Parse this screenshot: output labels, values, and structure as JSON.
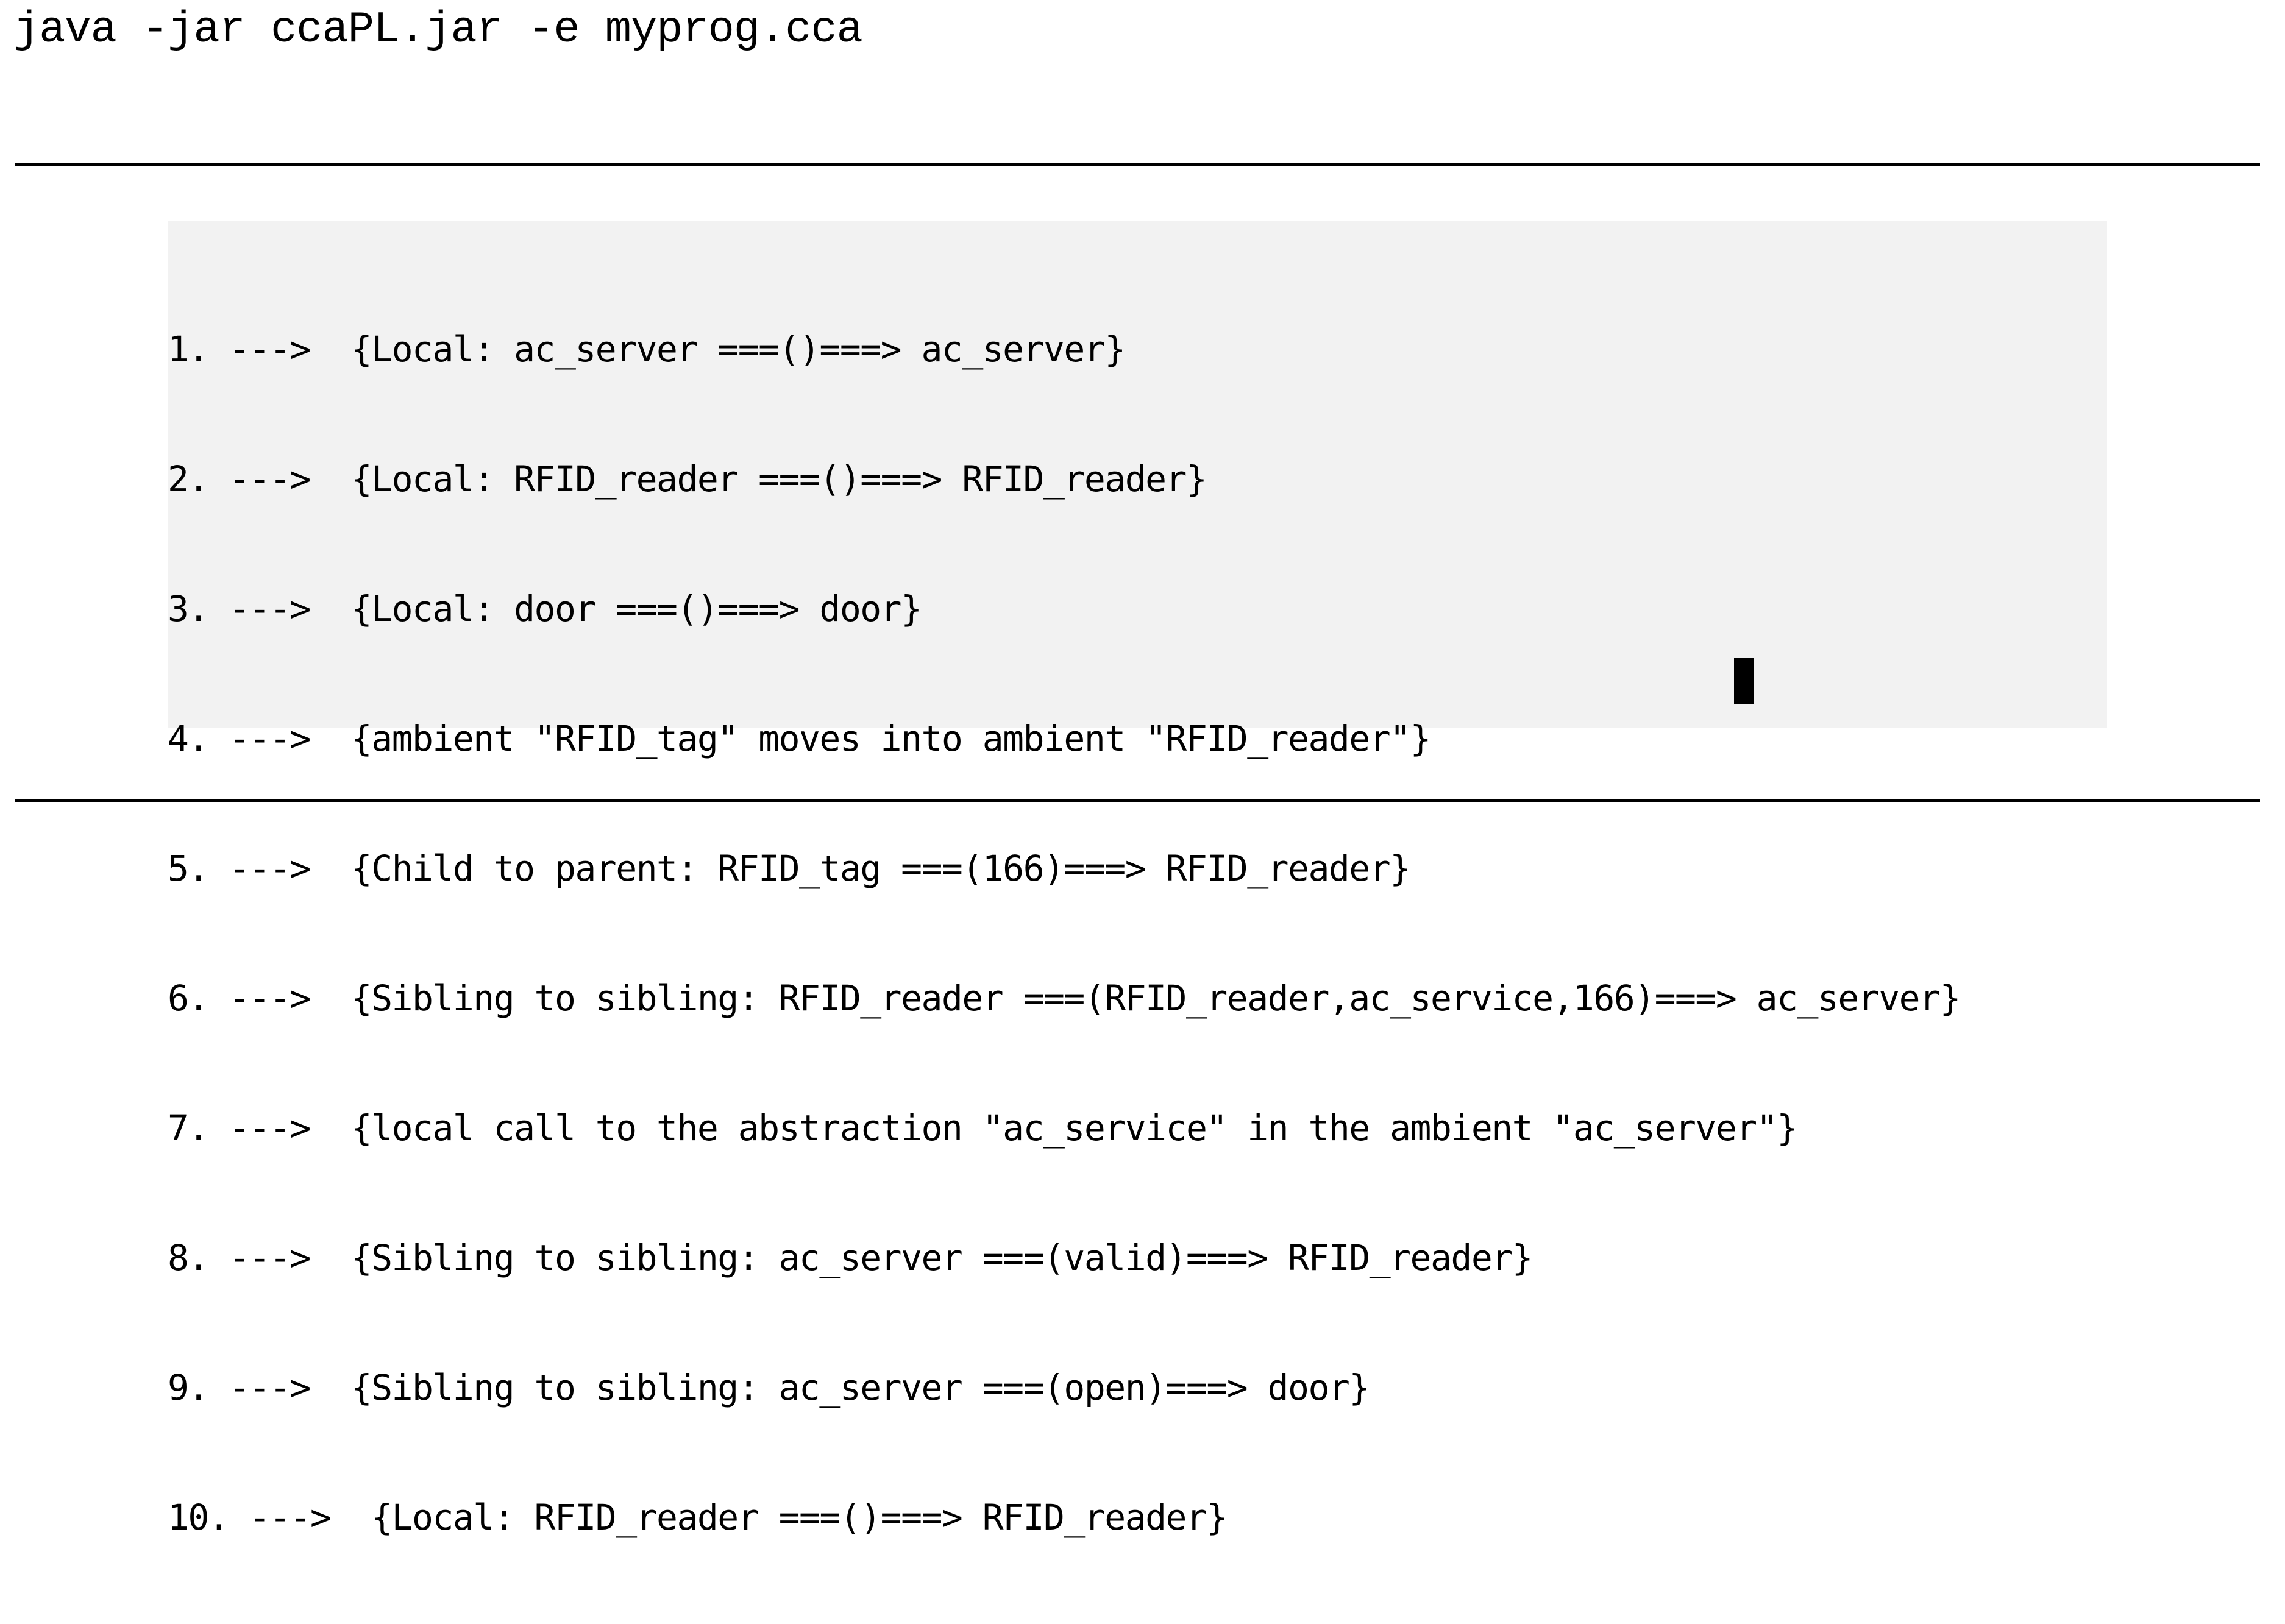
{
  "command": "java -jar ccaPL.jar -e myprog.cca",
  "console": {
    "lines": [
      "1. --->  {Local: ac_server ===()===> ac_server}",
      "2. --->  {Local: RFID_reader ===()===> RFID_reader}",
      "3. --->  {Local: door ===()===> door}",
      "4. --->  {ambient \"RFID_tag\" moves into ambient \"RFID_reader\"}",
      "5. --->  {Child to parent: RFID_tag ===(166)===> RFID_reader}",
      "6. --->  {Sibling to sibling: RFID_reader ===(RFID_reader,ac_service,166)===> ac_server}",
      "7. --->  {local call to the abstraction \"ac_service\" in the ambient \"ac_server\"}",
      "8. --->  {Sibling to sibling: ac_server ===(valid)===> RFID_reader}",
      "9. --->  {Sibling to sibling: ac_server ===(open)===> door}",
      "10. --->  {Local: RFID_reader ===()===> RFID_reader}"
    ],
    "background": "#f2f2f2"
  }
}
